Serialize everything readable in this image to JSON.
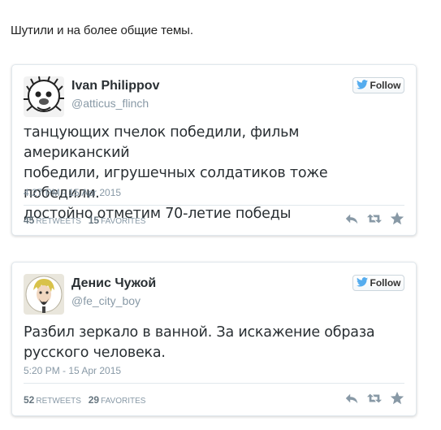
{
  "intro": "Шутили и на более общие темы.",
  "follow_label": "Follow",
  "tweets": [
    {
      "name": "Ivan Philippov",
      "handle": "@atticus_flinch",
      "lines": [
        "танцующих пчелок победили, фильм американский",
        "победили, игрушечных солдатиков тоже победили.",
        "достойно отметим 70-летие победы"
      ],
      "time": "4:27 PM - 15 Apr 2015",
      "retweets": "45",
      "retweets_label": "RETWEETS",
      "favorites": "15",
      "favorites_label": "FAVORITES"
    },
    {
      "name": "Денис Чужой",
      "handle": "@fe_city_boy",
      "lines": [
        "Разбил зеркало в ванной. За искажение образа",
        "русского человека."
      ],
      "time": "5:20 PM - 15 Apr 2015",
      "retweets": "52",
      "retweets_label": "RETWEETS",
      "favorites": "29",
      "favorites_label": "FAVORITES"
    }
  ],
  "colors": {
    "twitter_blue": "#55acee",
    "muted_text": "#8899a6",
    "border": "#e1e8ed"
  },
  "icons": [
    "twitter-bird-icon",
    "reply-icon",
    "retweet-icon",
    "favorite-star-icon"
  ]
}
